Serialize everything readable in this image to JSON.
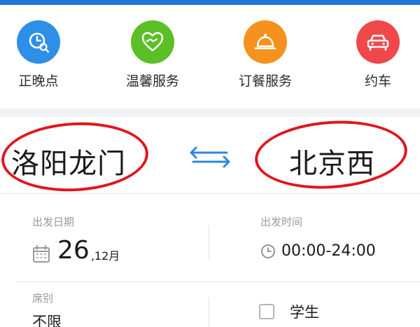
{
  "services": [
    {
      "label": "正晚点",
      "icon": "clock-search-icon",
      "color": "#2e8fe8"
    },
    {
      "label": "温馨服务",
      "icon": "heart-hands-icon",
      "color": "#5dbf28"
    },
    {
      "label": "订餐服务",
      "icon": "food-cloche-icon",
      "color": "#f5921e"
    },
    {
      "label": "约车",
      "icon": "car-icon",
      "color": "#f0484a"
    }
  ],
  "route": {
    "from_city": "洛阳龙门",
    "to_city": "北京西"
  },
  "details": {
    "date_caption": "出发日期",
    "date_day": "26",
    "date_month": ",12月",
    "time_caption": "出发时间",
    "time_value": "00:00-24:00",
    "seat_caption": "席别",
    "seat_value": "不限",
    "student_label": "学生"
  },
  "colors": {
    "accent_blue": "#1f74d8",
    "annotation_red": "#e0161e"
  }
}
